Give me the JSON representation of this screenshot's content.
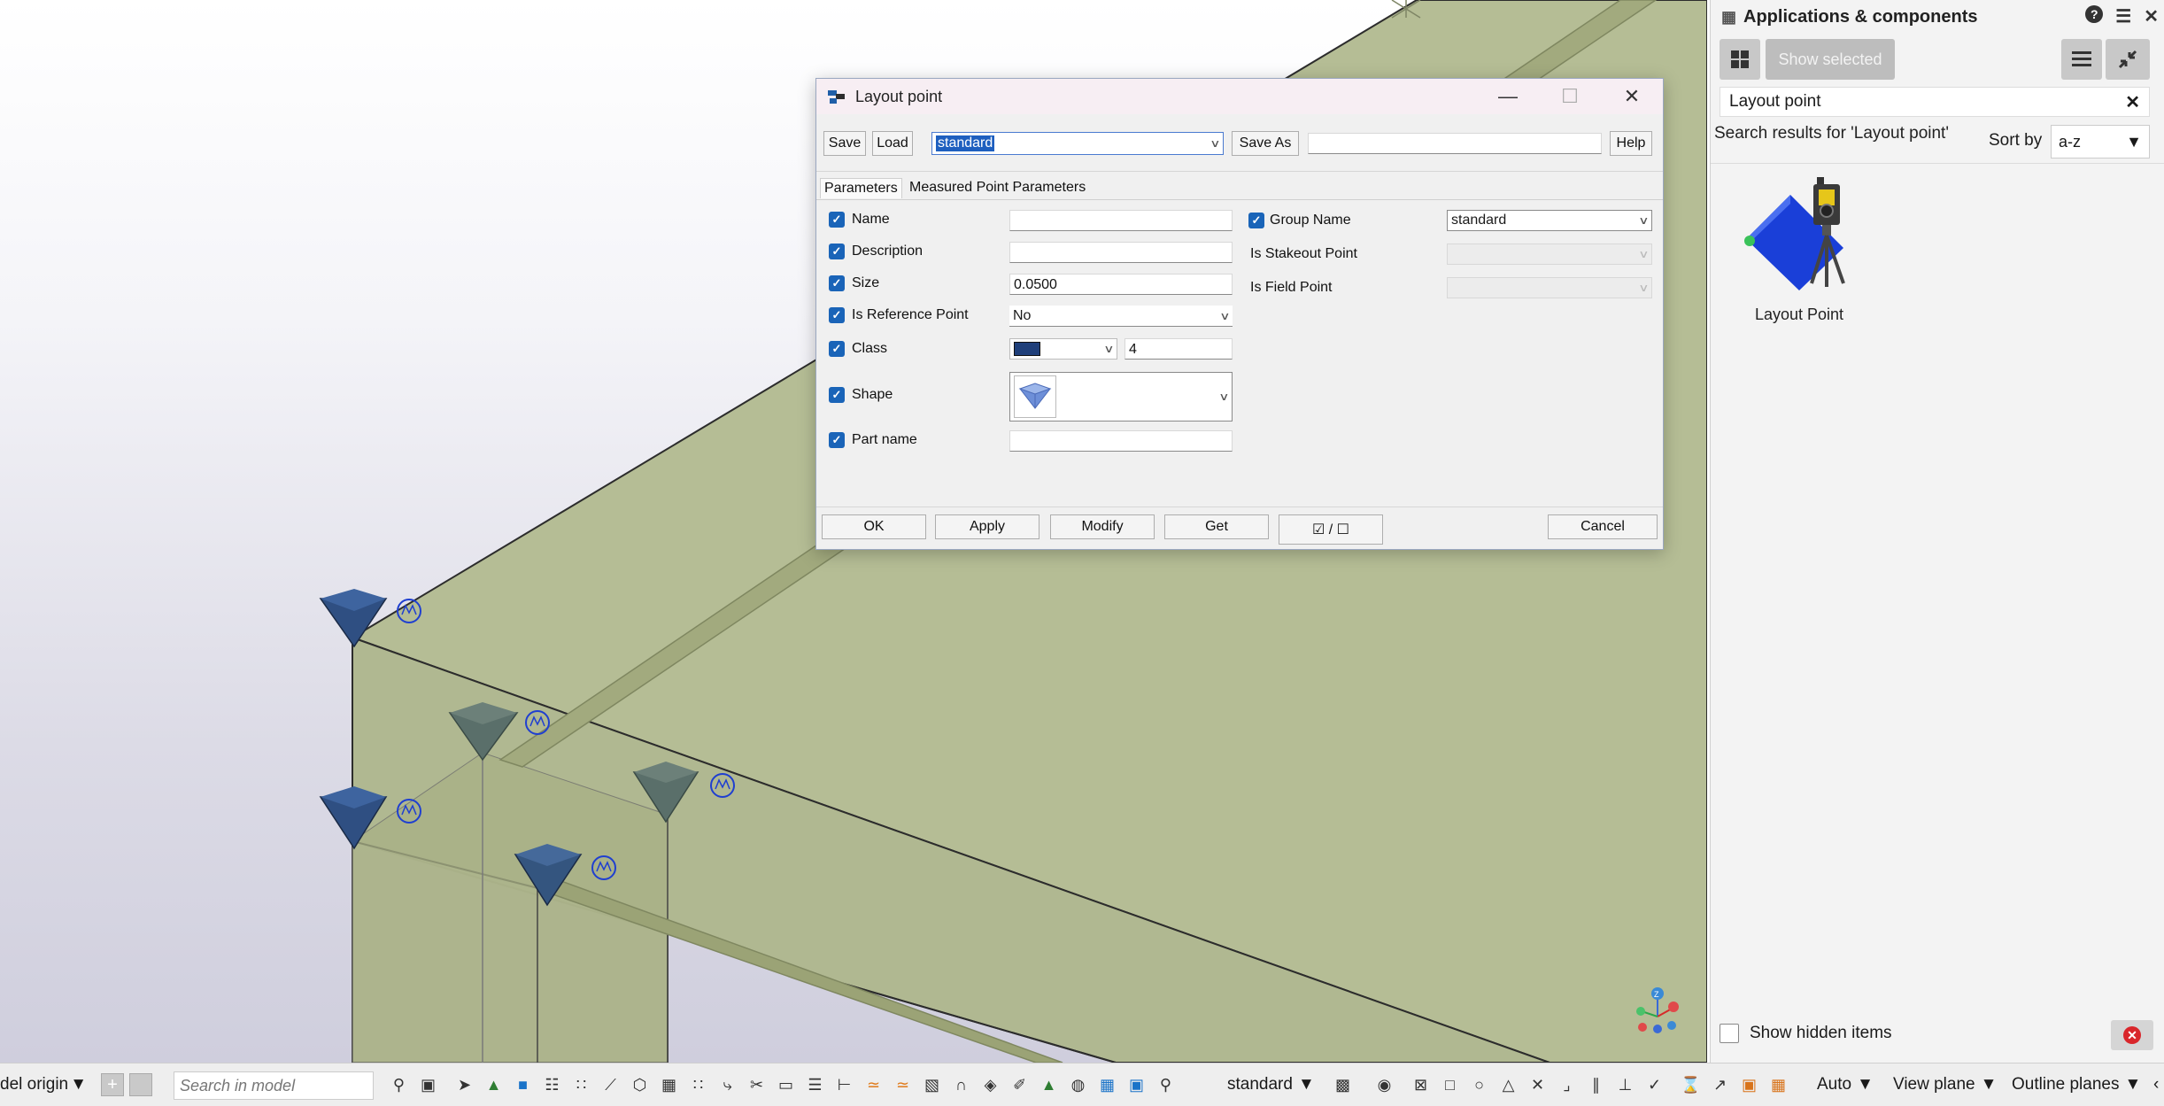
{
  "viewport": {
    "axis_labels": {
      "z": "Z"
    }
  },
  "dialog": {
    "title": "Layout point",
    "toolbar": {
      "save": "Save",
      "load": "Load",
      "preset_value": "standard",
      "save_as": "Save As",
      "save_as_name": "",
      "help": "Help"
    },
    "tabs": [
      "Parameters",
      "Measured Point Parameters"
    ],
    "left": {
      "name_label": "Name",
      "name_value": "",
      "description_label": "Description",
      "description_value": "",
      "size_label": "Size",
      "size_value": "0.0500",
      "is_reference_label": "Is Reference Point",
      "is_reference_value": "No",
      "class_label": "Class",
      "class_color": "#1f3f7a",
      "class_value": "4",
      "shape_label": "Shape",
      "part_name_label": "Part name",
      "part_name_value": ""
    },
    "right": {
      "group_name_label": "Group Name",
      "group_name_value": "standard",
      "is_stakeout_label": "Is Stakeout Point",
      "is_field_label": "Is Field Point"
    },
    "footer": {
      "ok": "OK",
      "apply": "Apply",
      "modify": "Modify",
      "get": "Get",
      "toggle": "☑ / ☐",
      "cancel": "Cancel"
    }
  },
  "right_panel": {
    "title": "Applications & components",
    "show_selected": "Show selected",
    "search_value": "Layout point",
    "results_text": "Search results for 'Layout point'",
    "sort_label": "Sort by",
    "sort_value": "a-z",
    "items": [
      {
        "label": "Layout Point",
        "icon": "layout-point-icon"
      }
    ],
    "show_hidden_label": "Show hidden items"
  },
  "bottom_toolbar": {
    "origin_value": "del origin",
    "search_placeholder": "Search in model",
    "standard_value": "standard",
    "auto_value": "Auto",
    "view_plane_value": "View plane",
    "outline_planes_value": "Outline planes"
  }
}
